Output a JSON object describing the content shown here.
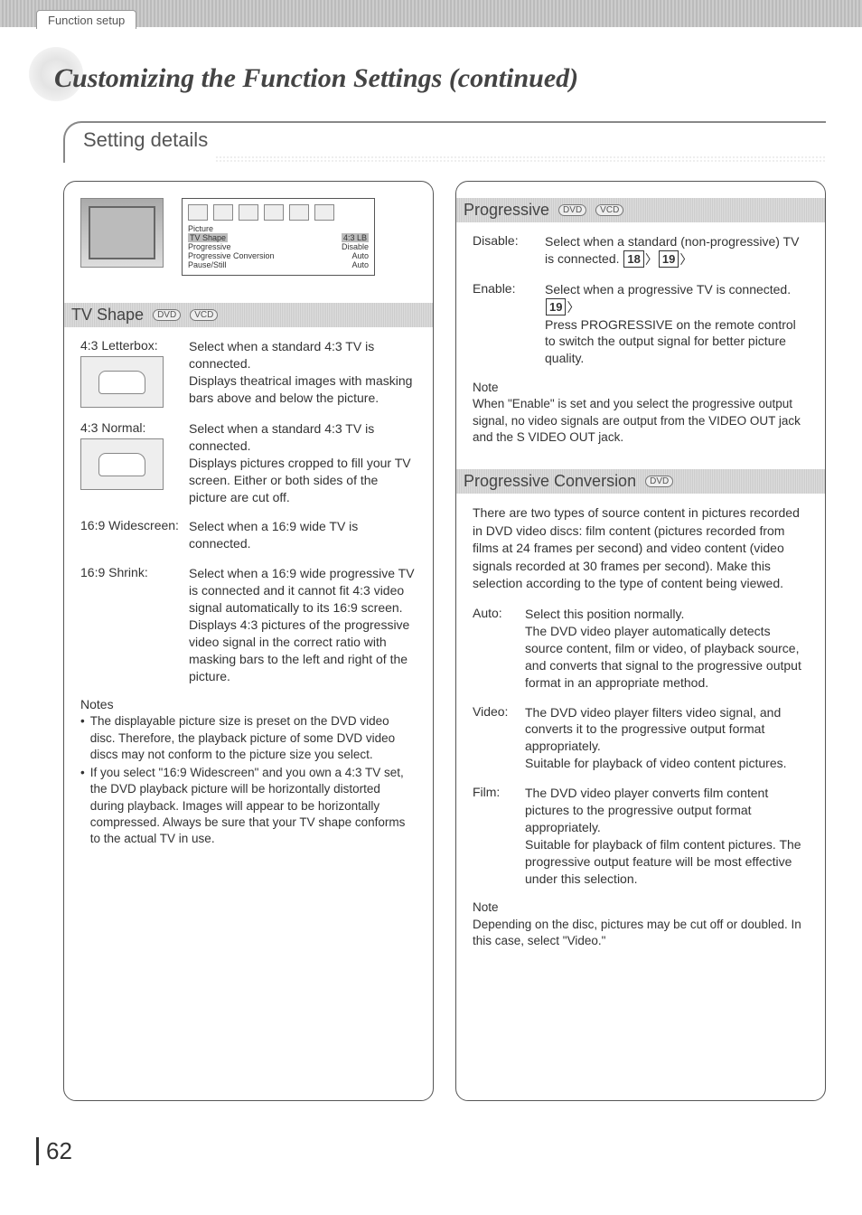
{
  "topbar": {
    "tab": "Function setup"
  },
  "page_title": "Customizing the Function Settings (continued)",
  "section_title": "Setting details",
  "osd": {
    "group": "Picture",
    "rows": [
      {
        "label": "TV Shape",
        "value": "4:3 LB",
        "selected": true
      },
      {
        "label": "Progressive",
        "value": "Disable"
      },
      {
        "label": "Progressive Conversion",
        "value": "Auto"
      },
      {
        "label": "Pause/Still",
        "value": "Auto"
      }
    ]
  },
  "tv_shape": {
    "heading": "TV Shape",
    "badges": [
      "DVD",
      "VCD"
    ],
    "options": [
      {
        "label": "4:3 Letterbox:",
        "desc": "Select when a standard 4:3 TV is connected.\nDisplays theatrical images with masking bars above and below the picture.",
        "thumb": true
      },
      {
        "label": "4:3 Normal:",
        "desc": "Select when a standard 4:3 TV is connected.\nDisplays pictures cropped to fill your TV screen. Either or both sides of the picture are cut off.",
        "thumb": true
      },
      {
        "label": "16:9 Widescreen:",
        "desc": "Select when a 16:9 wide TV is connected.",
        "thumb": false
      },
      {
        "label": "16:9 Shrink:",
        "desc": "Select when a 16:9 wide progressive TV is connected and it cannot fit 4:3 video signal automatically to its 16:9 screen. Displays 4:3 pictures of the progressive video signal in the correct ratio with masking bars to the left and right of the picture.",
        "thumb": false
      }
    ],
    "notes_heading": "Notes",
    "notes": [
      "The displayable picture size is preset on the DVD video disc. Therefore, the playback picture of some DVD video discs may not conform to the picture size you select.",
      "If you select \"16:9 Widescreen\" and you own a 4:3 TV set, the DVD playback picture will be horizontally distorted during playback. Images will appear to be horizontally compressed. Always be sure that your TV shape conforms to the actual TV in use."
    ]
  },
  "progressive": {
    "heading": "Progressive",
    "badges": [
      "DVD",
      "VCD"
    ],
    "options": [
      {
        "label": "Disable:",
        "desc": "Select when a standard (non-progressive) TV is connected.",
        "refs": [
          "18",
          "19"
        ]
      },
      {
        "label": "Enable:",
        "desc_pre": "Select when a progressive TV is connected.",
        "refs": [
          "19"
        ],
        "desc_post": "Press PROGRESSIVE on the remote control to switch the output signal for better picture quality."
      }
    ],
    "note_heading": "Note",
    "note": "When \"Enable\" is set and you select the progressive output signal, no video signals are output from the VIDEO OUT jack and the S VIDEO OUT jack."
  },
  "progressive_conversion": {
    "heading": "Progressive Conversion",
    "badges": [
      "DVD"
    ],
    "intro": "There are two types of source content in pictures recorded in DVD video discs: film content (pictures recorded from films at 24 frames per second) and video content (video signals recorded at 30 frames per second). Make this selection according to the type of content being viewed.",
    "options": [
      {
        "label": "Auto:",
        "desc": "Select this position normally.\nThe DVD video player automatically detects source content, film or video, of playback source, and converts that signal to the progressive output format in an appropriate method."
      },
      {
        "label": "Video:",
        "desc": "The DVD video player filters video signal, and converts it to the progressive output format appropriately.\nSuitable for playback of video content pictures."
      },
      {
        "label": "Film:",
        "desc": "The DVD video player converts film content pictures to the progressive output format appropriately.\nSuitable for playback of film content pictures. The progressive output feature will be most effective under this selection."
      }
    ],
    "note_heading": "Note",
    "note": "Depending on the disc, pictures may be cut off or doubled. In this case, select \"Video.\""
  },
  "page_number": "62"
}
